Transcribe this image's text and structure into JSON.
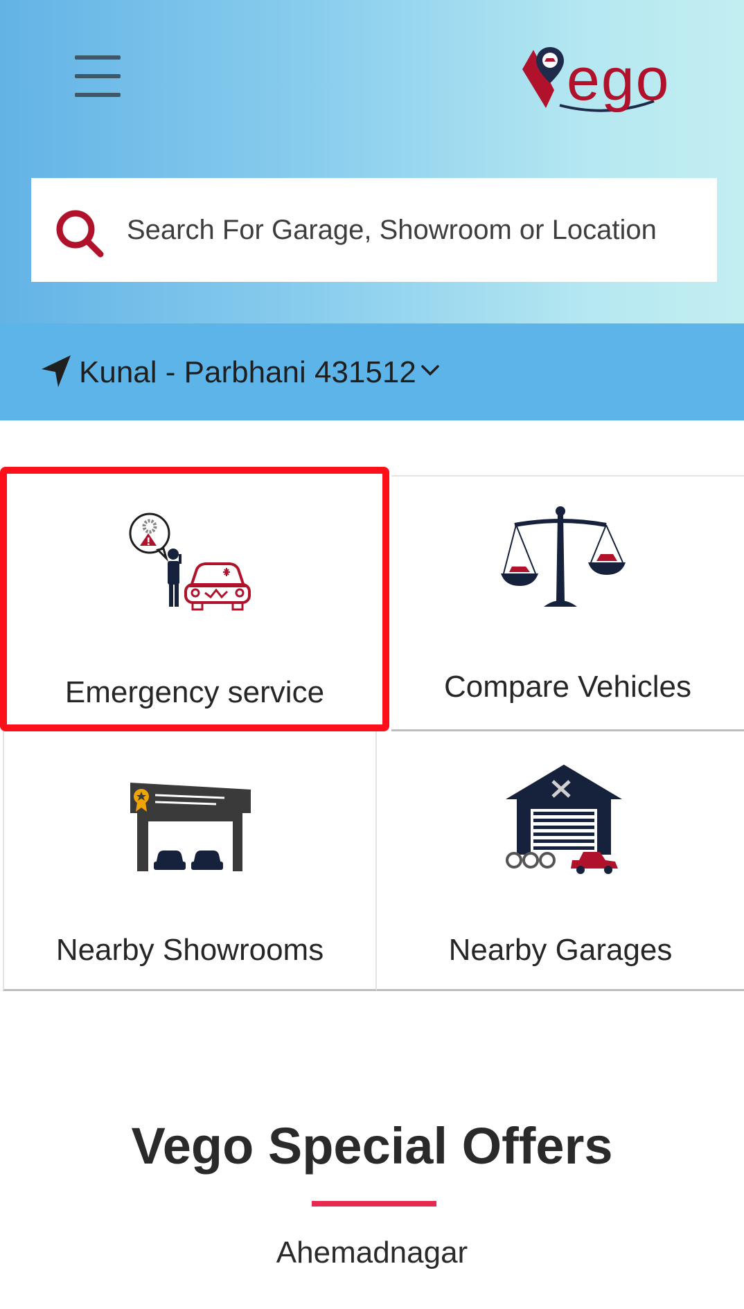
{
  "header": {
    "menu_icon": "hamburger-menu-icon",
    "logo_text": "Vego",
    "brand_color": "#b0122c"
  },
  "search": {
    "icon": "search-icon",
    "placeholder": "Search For Garage, Showroom or Location"
  },
  "location": {
    "icon": "navigation-arrow-icon",
    "text": "Kunal - Parbhani 431512",
    "dropdown_icon": "chevron-down-icon"
  },
  "services": {
    "emergency": {
      "label": "Emergency service",
      "icon": "emergency-breakdown-icon",
      "highlighted": true
    },
    "compare": {
      "label": "Compare Vehicles",
      "icon": "balance-scale-icon"
    },
    "showrooms": {
      "label": "Nearby Showrooms",
      "icon": "showroom-icon"
    },
    "garages": {
      "label": "Nearby Garages",
      "icon": "garage-icon"
    }
  },
  "offers": {
    "title": "Vego Special Offers",
    "city": "Ahemadnagar",
    "accent_color": "#e8294f"
  },
  "colors": {
    "highlight_border": "#ff0f19",
    "location_bar": "#5db4e8",
    "icon_dark": "#16213b",
    "icon_red": "#b0122c"
  }
}
